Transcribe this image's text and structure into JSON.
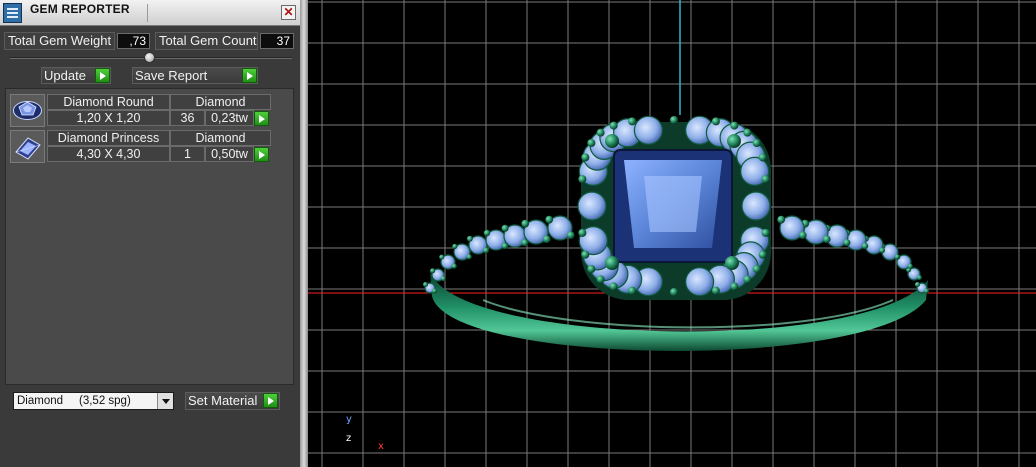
{
  "window": {
    "title": "GEM REPORTER",
    "close_glyph": "✕"
  },
  "totals": {
    "weight_label": "Total Gem Weight",
    "weight_value": ",73",
    "count_label": "Total Gem Count",
    "count_value": "37"
  },
  "actions": {
    "update_label": "Update",
    "save_label": "Save Report"
  },
  "gems": [
    {
      "icon": "diamond-round-icon",
      "name": "Diamond Round",
      "material": "Diamond",
      "size": "1,20 X 1,20",
      "count": "36",
      "weight": "0,23tw"
    },
    {
      "icon": "diamond-princess-icon",
      "name": "Diamond Princess",
      "material": "Diamond",
      "size": "4,30 X 4,30",
      "count": "1",
      "weight": "0,50tw"
    }
  ],
  "material": {
    "selected": "Diamond     (3,52 spg)",
    "set_label": "Set Material"
  },
  "viewport": {
    "axis_x": "x",
    "axis_y": "y",
    "axis_z": "z"
  },
  "colors": {
    "grid": "#7a7a7a",
    "metal": "#1f8f66",
    "gem_accent": "#5b85d8",
    "axis_x": "#ff2020",
    "axis_y": "#2fb4c8",
    "arrow_green": "#2fb02a"
  }
}
